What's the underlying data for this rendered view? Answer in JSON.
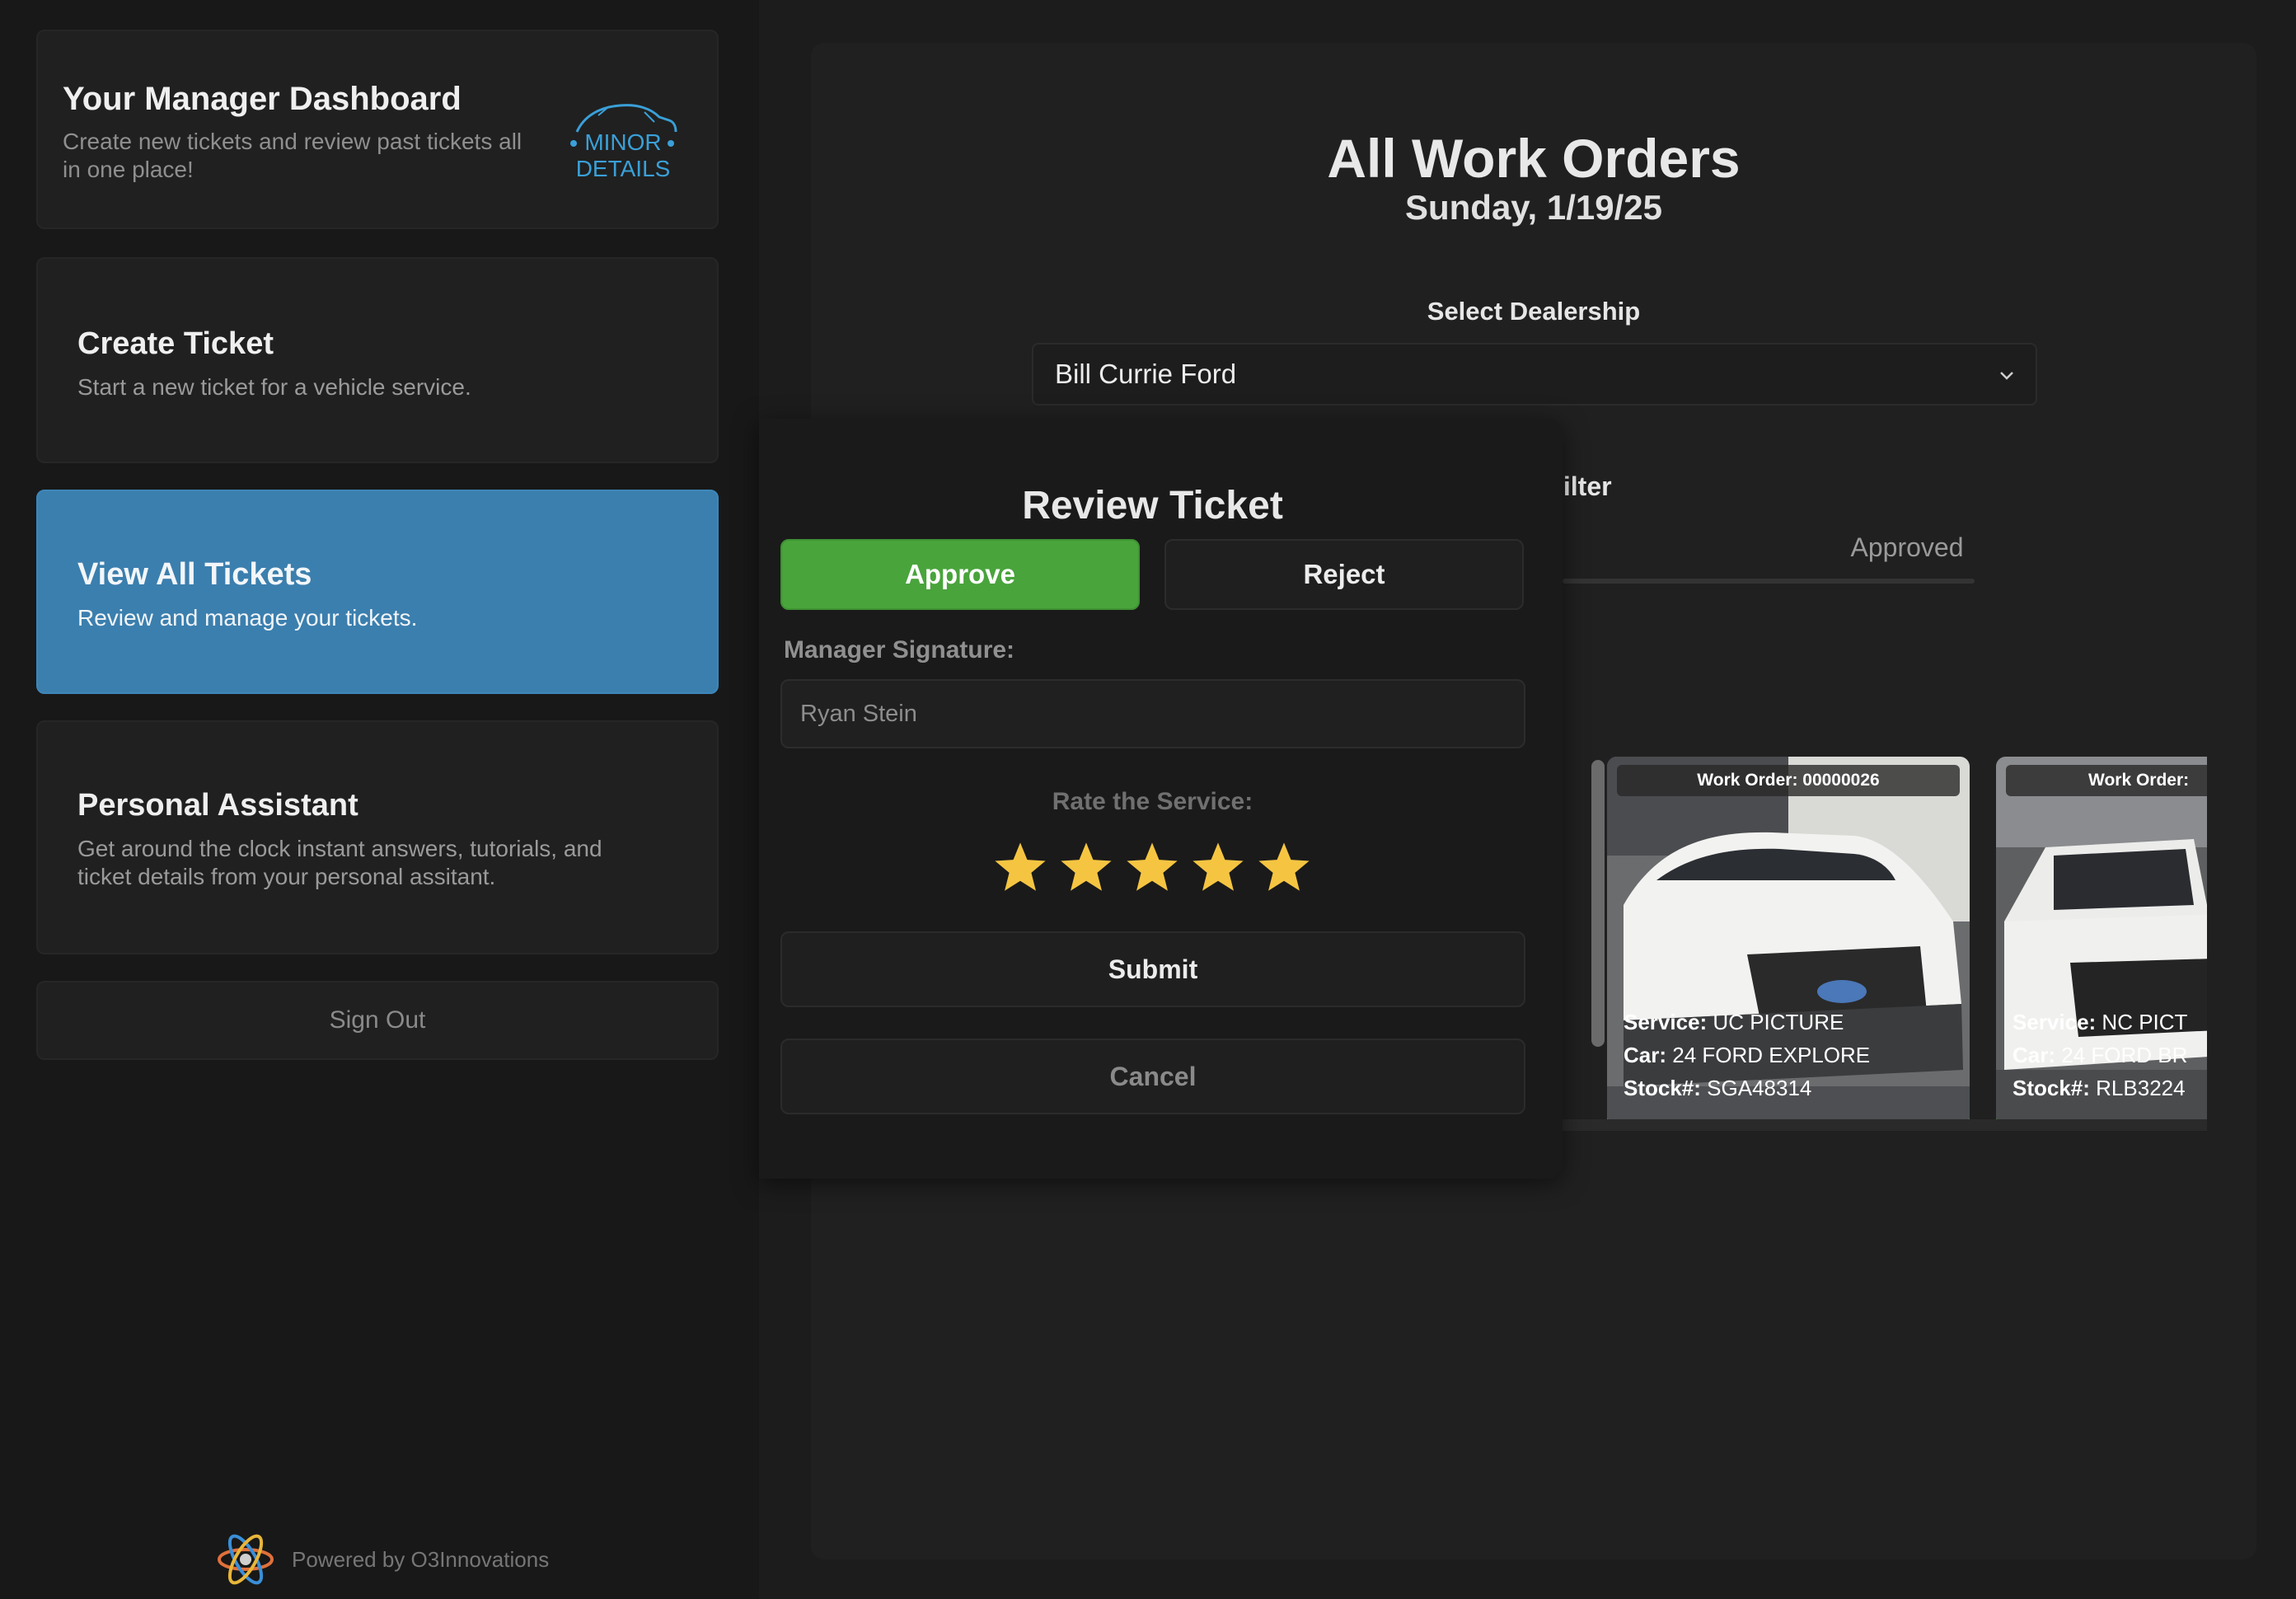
{
  "sidebar": {
    "header": {
      "title": "Your Manager Dashboard",
      "subtitle": "Create new tickets and review past tickets all in one place!",
      "logo_line1": "MINOR",
      "logo_line2": "DETAILS"
    },
    "items": [
      {
        "title": "Create Ticket",
        "subtitle": "Start a new ticket for a vehicle service."
      },
      {
        "title": "View All Tickets",
        "subtitle": "Review and manage your tickets."
      },
      {
        "title": "Personal Assistant",
        "subtitle": "Get around the clock instant answers, tutorials, and ticket details from your personal assitant."
      }
    ],
    "sign_out": "Sign Out",
    "powered_by": "Powered by O3Innovations"
  },
  "main": {
    "title": "All Work Orders",
    "date": "Sunday, 1/19/25",
    "dealership_label": "Select Dealership",
    "dealership_value": "Bill Currie Ford",
    "filter_label": "r Filter",
    "tab_approved": "Approved",
    "cards": [
      {
        "work_order": "Work Order: 00000026",
        "service_label": "Service:",
        "service": "UC PICTURE",
        "car_label": "Car:",
        "car": "24 FORD EXPLORE",
        "stock_label": "Stock#:",
        "stock": "SGA48314"
      },
      {
        "work_order": "Work Order:",
        "service_label": "Service:",
        "service": "NC PICT",
        "car_label": "Car:",
        "car": "24 FORD BR",
        "stock_label": "Stock#:",
        "stock": "RLB3224"
      }
    ]
  },
  "modal": {
    "title": "Review Ticket",
    "approve_label": "Approve",
    "reject_label": "Reject",
    "signature_label": "Manager Signature:",
    "signature_value": "Ryan Stein",
    "rate_label": "Rate the Service:",
    "rating": 5,
    "rating_max": 5,
    "submit_label": "Submit",
    "cancel_label": "Cancel"
  },
  "colors": {
    "accent_blue": "#3b7fae",
    "approve_green": "#49a43c",
    "star_yellow": "#f5c542",
    "logo_blue": "#3aa0d8"
  }
}
